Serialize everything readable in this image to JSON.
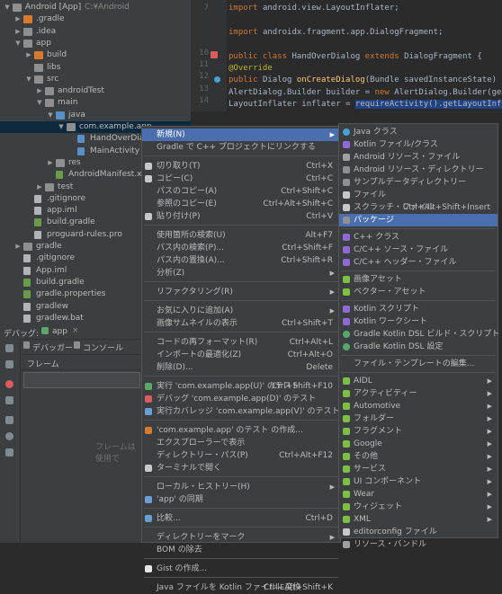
{
  "tree": {
    "rows": [
      {
        "label": "Android [App]",
        "sub": "C:¥Android",
        "indent": 0,
        "arrow": "▼",
        "kind": "folder",
        "color": "#8d8f91"
      },
      {
        "label": ".gradle",
        "indent": 1,
        "arrow": "▶",
        "kind": "folder",
        "color": "#d77a2e"
      },
      {
        "label": ".idea",
        "indent": 1,
        "arrow": "▶",
        "kind": "folder",
        "color": "#8d8f91"
      },
      {
        "label": "app",
        "indent": 1,
        "arrow": "▼",
        "kind": "folder",
        "color": "#8d8f91"
      },
      {
        "label": "build",
        "indent": 2,
        "arrow": "▶",
        "kind": "folder",
        "color": "#d77a2e"
      },
      {
        "label": "libs",
        "indent": 2,
        "arrow": "",
        "kind": "folder",
        "color": "#8d8f91"
      },
      {
        "label": "src",
        "indent": 2,
        "arrow": "▼",
        "kind": "folder",
        "color": "#8d8f91"
      },
      {
        "label": "androidTest",
        "indent": 3,
        "arrow": "▶",
        "kind": "folder",
        "color": "#8d8f91"
      },
      {
        "label": "main",
        "indent": 3,
        "arrow": "▼",
        "kind": "folder",
        "color": "#8d8f91"
      },
      {
        "label": "java",
        "indent": 4,
        "arrow": "▼",
        "kind": "folder",
        "color": "#5a8fc6"
      },
      {
        "label": "com.example.app",
        "indent": 5,
        "arrow": "▼",
        "kind": "folder",
        "color": "#8d8f91",
        "selected": true
      },
      {
        "label": "HandOverDialog",
        "indent": 6,
        "arrow": "",
        "kind": "file",
        "color": "#5a8fc6"
      },
      {
        "label": "MainActivity",
        "indent": 6,
        "arrow": "",
        "kind": "file",
        "color": "#5a8fc6"
      },
      {
        "label": "res",
        "indent": 4,
        "arrow": "▶",
        "kind": "folder",
        "color": "#8d8f91"
      },
      {
        "label": "AndroidManifest.xml",
        "indent": 4,
        "arrow": "",
        "kind": "file",
        "color": "#6a9a4a"
      },
      {
        "label": "test",
        "indent": 3,
        "arrow": "▶",
        "kind": "folder",
        "color": "#8d8f91"
      },
      {
        "label": ".gitignore",
        "indent": 2,
        "arrow": "",
        "kind": "file",
        "color": "#b0b4b8"
      },
      {
        "label": "app.iml",
        "indent": 2,
        "arrow": "",
        "kind": "file",
        "color": "#b0b4b8"
      },
      {
        "label": "build.gradle",
        "indent": 2,
        "arrow": "",
        "kind": "file",
        "color": "#6a9a4a"
      },
      {
        "label": "proguard-rules.pro",
        "indent": 2,
        "arrow": "",
        "kind": "file",
        "color": "#b0b4b8"
      },
      {
        "label": "gradle",
        "indent": 1,
        "arrow": "▶",
        "kind": "folder",
        "color": "#8d8f91"
      },
      {
        "label": ".gitignore",
        "indent": 1,
        "arrow": "",
        "kind": "file",
        "color": "#b0b4b8"
      },
      {
        "label": "App.iml",
        "indent": 1,
        "arrow": "",
        "kind": "file",
        "color": "#b0b4b8"
      },
      {
        "label": "build.gradle",
        "indent": 1,
        "arrow": "",
        "kind": "file",
        "color": "#6a9a4a"
      },
      {
        "label": "gradle.properties",
        "indent": 1,
        "arrow": "",
        "kind": "file",
        "color": "#6a9a4a"
      },
      {
        "label": "gradlew",
        "indent": 1,
        "arrow": "",
        "kind": "file",
        "color": "#b0b4b8"
      },
      {
        "label": "gradlew.bat",
        "indent": 1,
        "arrow": "",
        "kind": "file",
        "color": "#b0b4b8"
      }
    ]
  },
  "editor": {
    "line_numbers": [
      "7",
      "",
      "",
      "10",
      "11",
      "12",
      "13",
      "14"
    ],
    "lines": [
      [
        {
          "c": "kw",
          "t": "import "
        },
        {
          "c": "tx",
          "t": "android.view.LayoutInflater;"
        }
      ],
      [],
      [
        {
          "c": "kw",
          "t": "import "
        },
        {
          "c": "tx",
          "t": "androidx.fragment.app.DialogFragment;"
        }
      ],
      [],
      [
        {
          "c": "kw",
          "t": "public class "
        },
        {
          "c": "tx",
          "t": "HandOverDialog "
        },
        {
          "c": "kw",
          "t": "extends "
        },
        {
          "c": "tx",
          "t": "DialogFragment {"
        }
      ],
      [
        {
          "c": "an",
          "t": "    @Override"
        }
      ],
      [
        {
          "c": "kw",
          "t": "    public "
        },
        {
          "c": "tx",
          "t": "Dialog "
        },
        {
          "c": "fn",
          "t": "onCreateDialog"
        },
        {
          "c": "tx",
          "t": "(Bundle savedInstanceState) {"
        }
      ],
      [
        {
          "c": "tx",
          "t": "        AlertDialog.Builder builder = "
        },
        {
          "c": "kw",
          "t": "new "
        },
        {
          "c": "tx",
          "t": "AlertDialog.Builder(geta"
        }
      ],
      [
        {
          "c": "tx",
          "t": "        LayoutInflater inflater = "
        },
        {
          "c": "hl",
          "t": "requireActivity().getLayoutInfla"
        }
      ]
    ]
  },
  "debug": {
    "title": "デバッグ:",
    "tab": "app",
    "subtabs": [
      "デバッガー",
      "コンソール"
    ],
    "frame_label": "フレーム",
    "placeholder": "フレームは使用で"
  },
  "context_menu": {
    "items": [
      {
        "label": "新規(N)",
        "sub": true,
        "highlight": true,
        "icon": ""
      },
      {
        "label": "Gradle で C++ プロジェクトにリンクする"
      },
      {
        "sep": true
      },
      {
        "label": "切り取り(T)",
        "key": "Ctrl+X",
        "icon": "#c8c8c8"
      },
      {
        "label": "コピー(C)",
        "key": "Ctrl+C",
        "icon": "#c8c8c8"
      },
      {
        "label": "パスのコピー(A)",
        "key": "Ctrl+Shift+C"
      },
      {
        "label": "参照のコピー(E)",
        "key": "Ctrl+Alt+Shift+C"
      },
      {
        "label": "貼り付け(P)",
        "key": "Ctrl+V",
        "icon": "#c8c8c8"
      },
      {
        "sep": true
      },
      {
        "label": "使用箇所の検索(U)",
        "key": "Alt+F7"
      },
      {
        "label": "パス内の検索(P)...",
        "key": "Ctrl+Shift+F"
      },
      {
        "label": "パス内の置換(A)...",
        "key": "Ctrl+Shift+R"
      },
      {
        "label": "分析(Z)",
        "sub": true
      },
      {
        "sep": true
      },
      {
        "label": "リファクタリング(R)",
        "sub": true
      },
      {
        "sep": true
      },
      {
        "label": "お気に入りに追加(A)",
        "sub": true
      },
      {
        "label": "画像サムネイルの表示",
        "key": "Ctrl+Shift+T"
      },
      {
        "sep": true
      },
      {
        "label": "コードの再フォーマット(R)",
        "key": "Ctrl+Alt+L"
      },
      {
        "label": "インポートの最適化(Z)",
        "key": "Ctrl+Alt+O"
      },
      {
        "label": "削除(D)...",
        "key": "Delete"
      },
      {
        "sep": true
      },
      {
        "label": "実行 'com.example.app(U)' のテスト",
        "key": "Ctrl+Shift+F10",
        "icon": "#59a869"
      },
      {
        "label": "デバッグ 'com.example.app(D)' のテスト",
        "icon": "#db5c5c"
      },
      {
        "label": "実行カバレッジ 'com.example.app(V)' のテスト",
        "icon": "#6a9ed3"
      },
      {
        "sep": true
      },
      {
        "label": "'com.example.app' のテスト の作成...",
        "icon": "#d77a2e"
      },
      {
        "label": "エクスプローラーで表示"
      },
      {
        "label": "ディレクトリー・パス(P)",
        "key": "Ctrl+Alt+F12"
      },
      {
        "label": "ターミナルで開く",
        "icon": "#c8c8c8"
      },
      {
        "sep": true
      },
      {
        "label": "ローカル・ヒストリー(H)",
        "sub": true
      },
      {
        "label": "'app' の同期",
        "icon": "#6a9ed3"
      },
      {
        "sep": true
      },
      {
        "label": "比較...",
        "key": "Ctrl+D",
        "icon": "#6a9ed3"
      },
      {
        "sep": true
      },
      {
        "label": "ディレクトリーをマーク",
        "sub": true
      },
      {
        "label": "BOM の除去"
      },
      {
        "sep": true
      },
      {
        "label": "Gist の作成...",
        "icon": "#e6e6e6"
      },
      {
        "sep": true
      },
      {
        "label": "Java ファイルを Kotlin ファイルに変換",
        "key": "Ctrl+Alt+Shift+K"
      }
    ]
  },
  "new_menu": {
    "items": [
      {
        "label": "Java クラス",
        "icon": "#4a9fd6",
        "round": true
      },
      {
        "label": "Kotlin ファイル/クラス",
        "icon": "#8f6ad6"
      },
      {
        "label": "Android リソース・ファイル",
        "icon": "#a0a0a0"
      },
      {
        "label": "Android リソース・ディレクトリー",
        "icon": "#8d8f91"
      },
      {
        "label": "サンプルデータディレクトリー",
        "icon": "#8d8f91"
      },
      {
        "label": "ファイル",
        "icon": "#c8c8c8"
      },
      {
        "label": "スクラッチ・ファイル",
        "key": "Ctrl+Alt+Shift+Insert",
        "icon": "#c8c8c8"
      },
      {
        "label": "パッケージ",
        "icon": "#8d8f91",
        "highlight": true
      },
      {
        "sep": true
      },
      {
        "label": "C++ クラス",
        "icon": "#8f6ad6"
      },
      {
        "label": "C/C++ ソース・ファイル",
        "icon": "#8f6ad6"
      },
      {
        "label": "C/C++ ヘッダー・ファイル",
        "icon": "#8f6ad6"
      },
      {
        "sep": true
      },
      {
        "label": "画像アセット",
        "icon": "#7fbf3f"
      },
      {
        "label": "ベクター・アセット",
        "icon": "#7fbf3f"
      },
      {
        "sep": true
      },
      {
        "label": "Kotlin スクリプト",
        "icon": "#8f6ad6"
      },
      {
        "label": "Kotlin ワークシート",
        "icon": "#8f6ad6"
      },
      {
        "label": "Gradle Kotlin DSL ビルド・スクリプト",
        "icon": "#59a869",
        "round": true
      },
      {
        "label": "Gradle Kotlin DSL 設定",
        "icon": "#59a869",
        "round": true
      },
      {
        "sep": true
      },
      {
        "label": "ファイル・テンプレートの編集..."
      },
      {
        "sep": true
      },
      {
        "label": "AIDL",
        "sub": true,
        "icon": "#7fbf3f"
      },
      {
        "label": "アクティビティー",
        "sub": true,
        "icon": "#7fbf3f"
      },
      {
        "label": "Automotive",
        "sub": true,
        "icon": "#7fbf3f"
      },
      {
        "label": "フォルダー",
        "sub": true,
        "icon": "#7fbf3f"
      },
      {
        "label": "フラグメント",
        "sub": true,
        "icon": "#7fbf3f"
      },
      {
        "label": "Google",
        "sub": true,
        "icon": "#7fbf3f"
      },
      {
        "label": "その他",
        "sub": true,
        "icon": "#7fbf3f"
      },
      {
        "label": "サービス",
        "sub": true,
        "icon": "#7fbf3f"
      },
      {
        "label": "UI コンポーネント",
        "sub": true,
        "icon": "#7fbf3f"
      },
      {
        "label": "Wear",
        "sub": true,
        "icon": "#7fbf3f"
      },
      {
        "label": "ウィジェット",
        "sub": true,
        "icon": "#7fbf3f"
      },
      {
        "label": "XML",
        "sub": true,
        "icon": "#7fbf3f"
      },
      {
        "label": "editorconfig ファイル",
        "icon": "#c8c8c8"
      },
      {
        "label": "リソース・バンドル",
        "icon": "#a0a0a0"
      }
    ]
  }
}
